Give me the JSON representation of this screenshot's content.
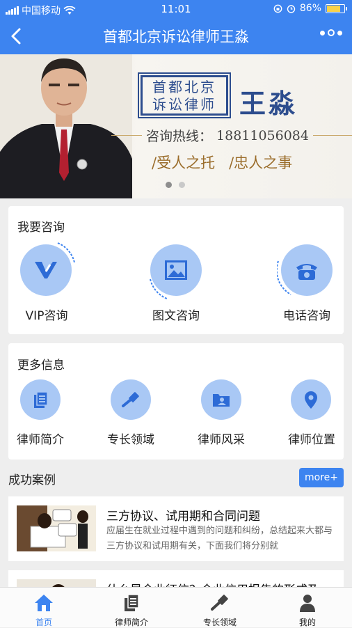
{
  "status_bar": {
    "carrier": "中国移动",
    "time": "11:01",
    "battery": "86%",
    "battery_level": 0.86
  },
  "nav": {
    "title": "首都北京诉讼律师王淼",
    "back_icon": "back-chevron-icon",
    "more_icon": "more-dots-icon"
  },
  "banner": {
    "seal_line1": "首都北京",
    "seal_line2": "诉讼律师",
    "name": "王淼",
    "hotline_label": "咨询热线：",
    "hotline_number": "18811056084",
    "slogan1": "/受人之托",
    "slogan2": "/忠人之事",
    "slide_count": 2,
    "active_slide": 1
  },
  "consult": {
    "title": "我要咨询",
    "items": [
      {
        "label": "VIP咨询",
        "icon": "vip-icon"
      },
      {
        "label": "图文咨询",
        "icon": "image-icon"
      },
      {
        "label": "电话咨询",
        "icon": "phone-icon"
      }
    ]
  },
  "more_info": {
    "title": "更多信息",
    "items": [
      {
        "label": "律师简介",
        "icon": "document-icon"
      },
      {
        "label": "专长领域",
        "icon": "gavel-icon"
      },
      {
        "label": "律师风采",
        "icon": "folder-user-icon"
      },
      {
        "label": "律师位置",
        "icon": "location-icon"
      }
    ]
  },
  "cases": {
    "title": "成功案例",
    "more_label": "more+",
    "items": [
      {
        "title": "三方协议、试用期和合同问题",
        "desc": "应届生在就业过程中遇到的问题和纠纷，总结起来大都与三方协议和试用期有关，下面我们将分别就"
      },
      {
        "title": "什么是企业征信？企业信用报告的形成及",
        "desc": ""
      }
    ]
  },
  "tabbar": {
    "items": [
      {
        "label": "首页",
        "icon": "home-icon",
        "active": true
      },
      {
        "label": "律师简介",
        "icon": "document-icon",
        "active": false
      },
      {
        "label": "专长领域",
        "icon": "gavel-icon",
        "active": false
      },
      {
        "label": "我的",
        "icon": "user-icon",
        "active": false
      }
    ]
  },
  "colors": {
    "primary": "#3d84f0",
    "icon_bg": "#a9c8f5",
    "brand_navy": "#2d4d8e",
    "gold": "#9a6c2a"
  }
}
